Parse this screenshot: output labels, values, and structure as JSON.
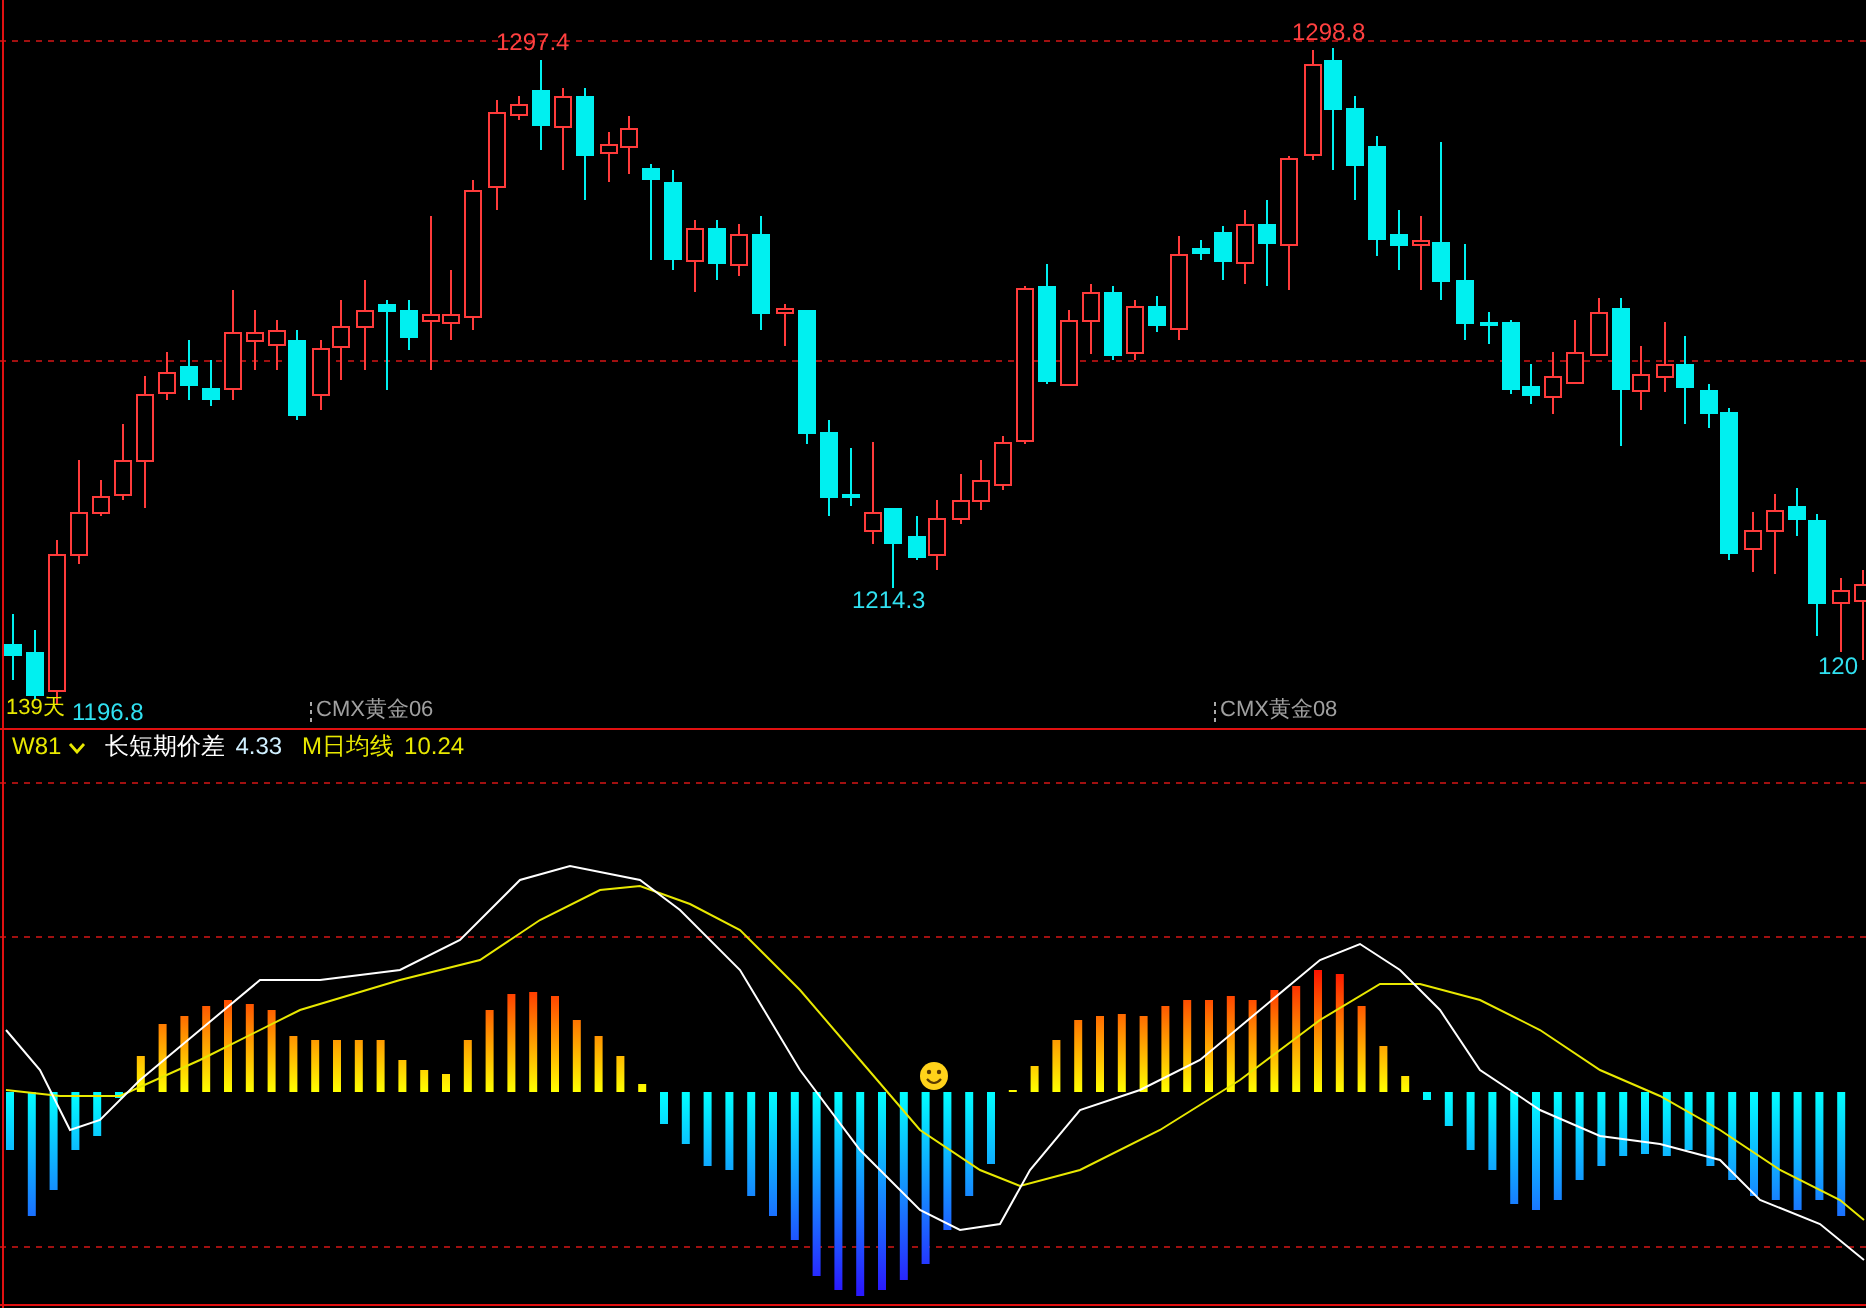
{
  "price_chart": {
    "extreme_labels": [
      {
        "text": "1297.4",
        "kind": "high"
      },
      {
        "text": "1298.8",
        "kind": "high"
      },
      {
        "text": "1214.3",
        "kind": "low"
      },
      {
        "text": "120",
        "kind": "low"
      }
    ],
    "range_label": "139天",
    "start_label": "1196.8",
    "contract_labels": [
      "CMX黄金06",
      "CMX黄金08"
    ]
  },
  "indicator": {
    "name": "W81",
    "series": [
      {
        "name": "长短期价差",
        "value": "4.33",
        "kind": "diff"
      },
      {
        "name": "M日均线",
        "value": "10.24",
        "kind": "average"
      }
    ]
  }
}
